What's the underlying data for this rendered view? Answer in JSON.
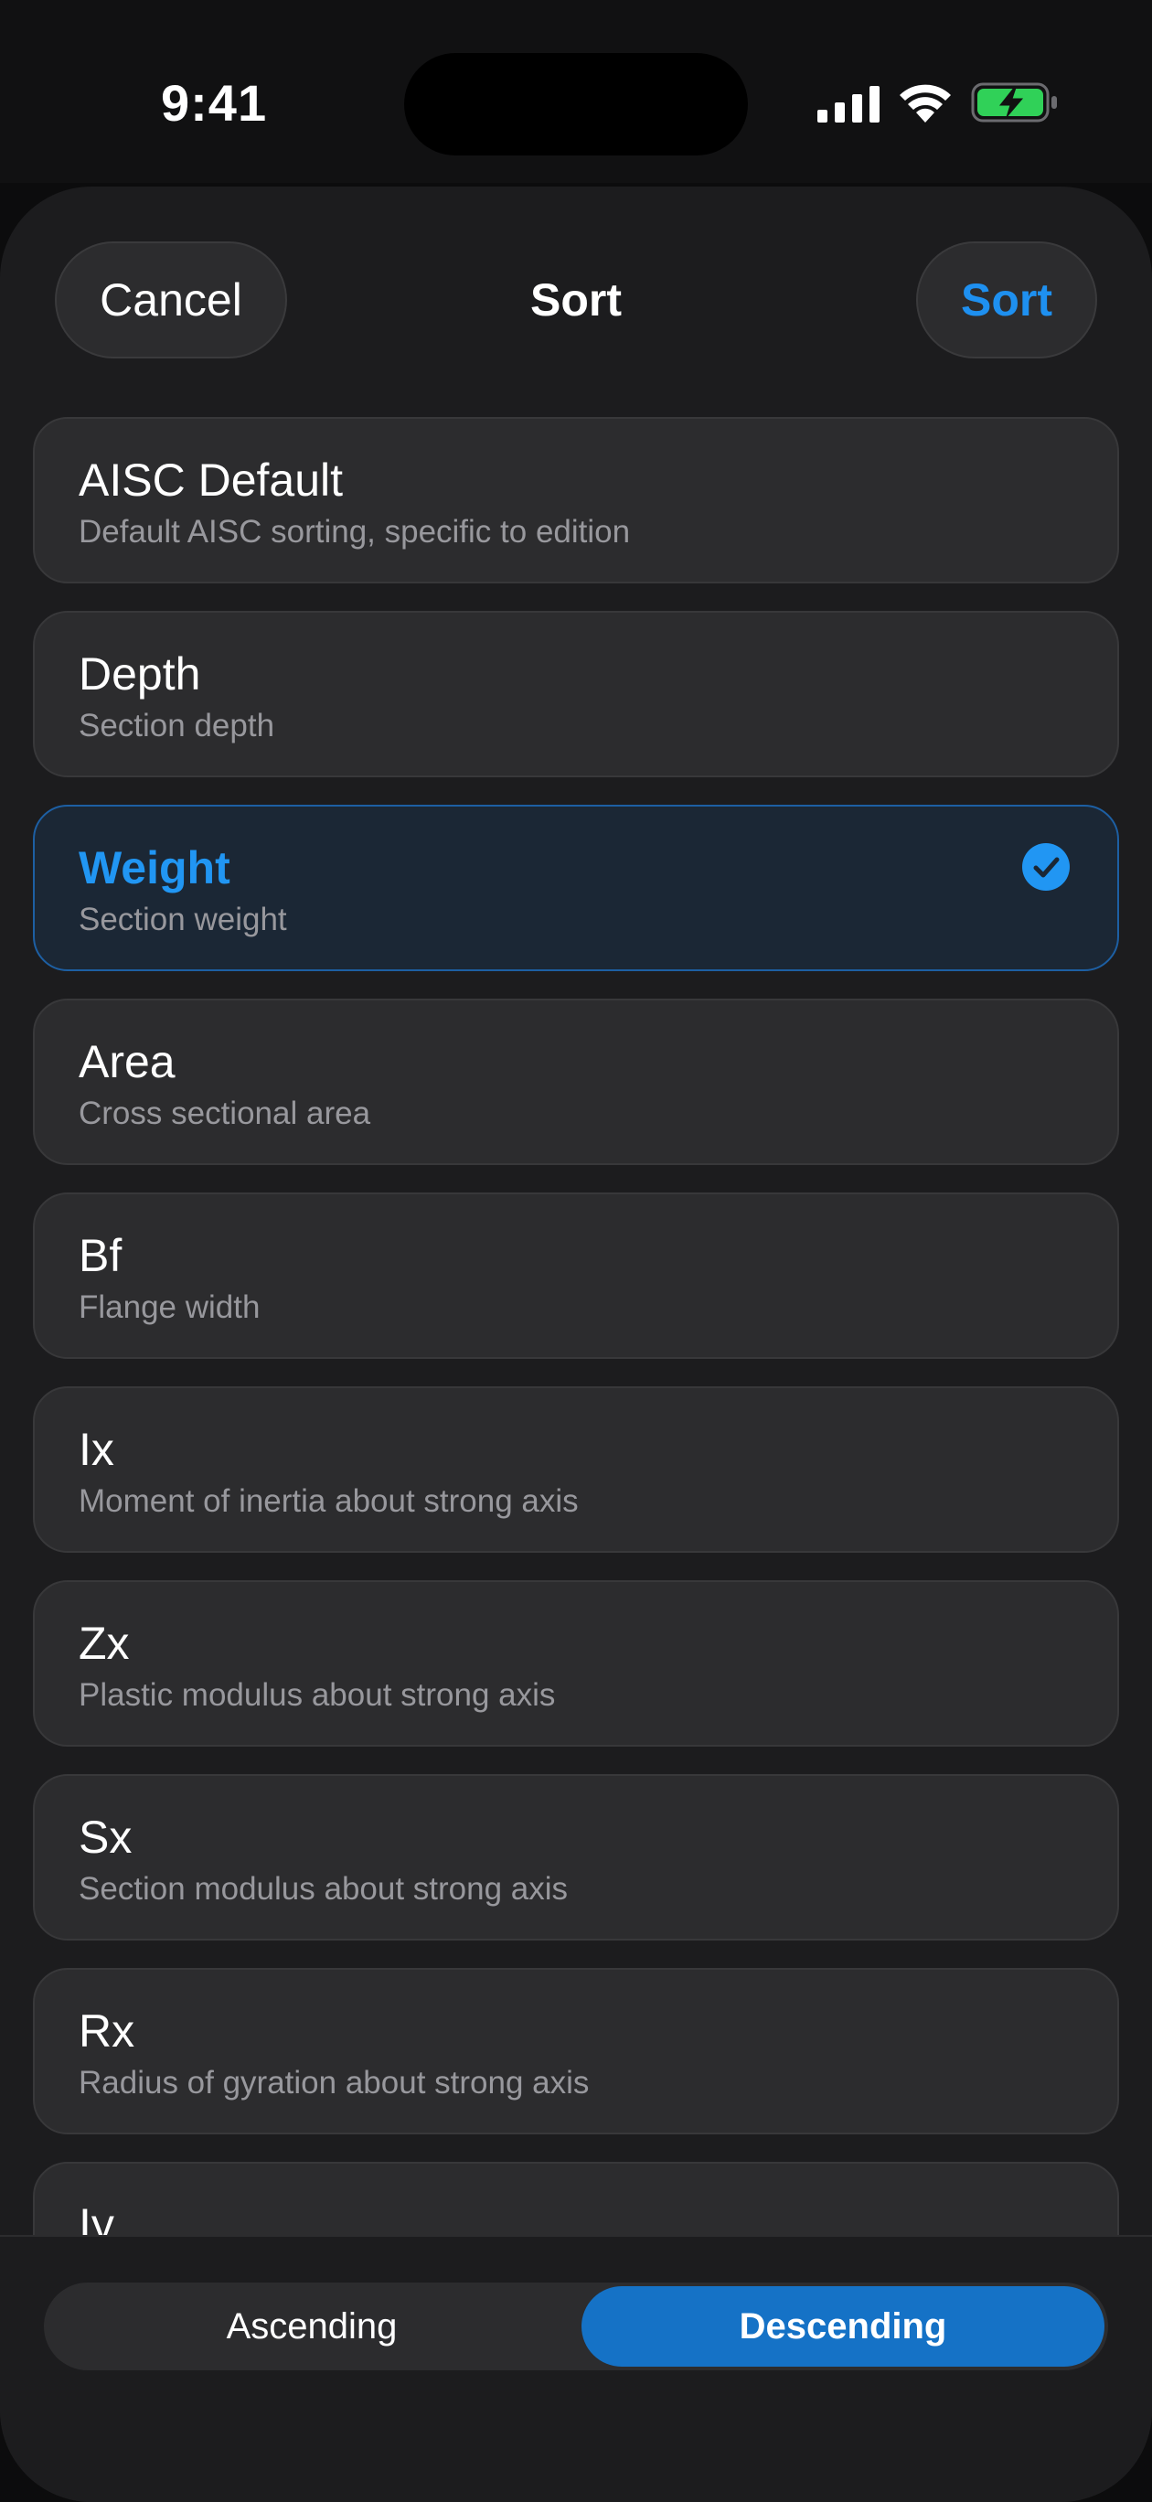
{
  "status_bar": {
    "time": "9:41",
    "icons": [
      "signal-icon",
      "wifi-icon",
      "battery-charging-icon"
    ]
  },
  "header": {
    "cancel_label": "Cancel",
    "title": "Sort",
    "sort_label": "Sort"
  },
  "options": [
    {
      "label": "AISC Default",
      "description": "Default AISC sorting, specific to edition",
      "selected": false
    },
    {
      "label": "Depth",
      "description": "Section depth",
      "selected": false
    },
    {
      "label": "Weight",
      "description": "Section weight",
      "selected": true
    },
    {
      "label": "Area",
      "description": "Cross sectional area",
      "selected": false
    },
    {
      "label": "Bf",
      "description": "Flange width",
      "selected": false
    },
    {
      "label": "Ix",
      "description": "Moment of inertia about strong axis",
      "selected": false
    },
    {
      "label": "Zx",
      "description": "Plastic modulus about strong axis",
      "selected": false
    },
    {
      "label": "Sx",
      "description": "Section modulus about strong axis",
      "selected": false
    },
    {
      "label": "Rx",
      "description": "Radius of gyration about strong axis",
      "selected": false
    },
    {
      "label": "Iy",
      "description": "",
      "selected": false
    }
  ],
  "order": {
    "ascending_label": "Ascending",
    "descending_label": "Descending",
    "selected": "Descending"
  },
  "colors": {
    "accent": "#1e90f0",
    "selected_segment": "#1572c6",
    "background": "#1c1c1e",
    "card": "#2c2c2e",
    "battery": "#30d158"
  }
}
